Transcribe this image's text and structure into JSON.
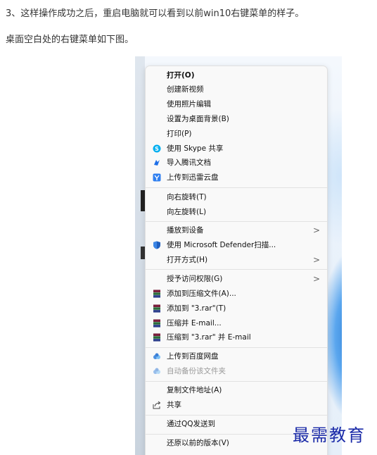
{
  "article": {
    "paragraph_1": "3、这样操作成功之后，重启电脑就可以看到以前win10右键菜单的样子。",
    "paragraph_2": "桌面空白处的右键菜单如下图。"
  },
  "context_menu": {
    "items": [
      {
        "label": "打开(O)",
        "icon": ""
      },
      {
        "label": "创建新视频",
        "icon": ""
      },
      {
        "label": "使用照片编辑",
        "icon": ""
      },
      {
        "label": "设置为桌面背景(B)",
        "icon": ""
      },
      {
        "label": "打印(P)",
        "icon": ""
      },
      {
        "label": "使用 Skype 共享",
        "icon": "skype-icon"
      },
      {
        "label": "导入腾讯文档",
        "icon": "tencent-docs-icon"
      },
      {
        "label": "上传到迅雷云盘",
        "icon": "xunlei-cloud-icon"
      },
      {
        "label": "向右旋转(T)",
        "icon": ""
      },
      {
        "label": "向左旋转(L)",
        "icon": ""
      },
      {
        "label": "播放到设备",
        "icon": "",
        "submenu_arrow": ">"
      },
      {
        "label": "使用 Microsoft Defender扫描...",
        "icon": "defender-shield-icon"
      },
      {
        "label": "打开方式(H)",
        "icon": "",
        "submenu_arrow": ">"
      },
      {
        "label": "授予访问权限(G)",
        "icon": "",
        "submenu_arrow": ">"
      },
      {
        "label": "添加到压缩文件(A)...",
        "icon": "winrar-icon"
      },
      {
        "label": "添加到 \"3.rar\"(T)",
        "icon": "winrar-icon"
      },
      {
        "label": "压缩并 E-mail...",
        "icon": "winrar-icon"
      },
      {
        "label": "压缩到 \"3.rar\" 并 E-mail",
        "icon": "winrar-icon"
      },
      {
        "label": "上传到百度网盘",
        "icon": "baidu-netdisk-icon"
      },
      {
        "label": "自动备份该文件夹",
        "icon": "baidu-netdisk-icon"
      },
      {
        "label": "复制文件地址(A)",
        "icon": ""
      },
      {
        "label": "共享",
        "icon": "share-icon"
      },
      {
        "label": "通过QQ发送到",
        "icon": ""
      },
      {
        "label": "还原以前的版本(V)",
        "icon": ""
      }
    ]
  },
  "watermark": "最需教育",
  "colors": {
    "watermark": "#1a2aa8",
    "skype": "#00aff0",
    "defender": "#1f5fbf",
    "winrar": "#7a1f3d",
    "baidu": "#4a8fe0"
  }
}
